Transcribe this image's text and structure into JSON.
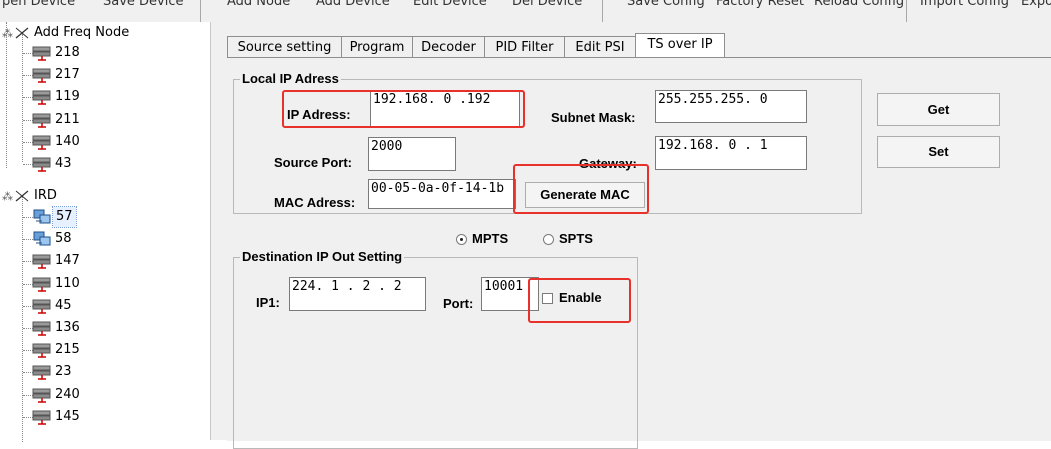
{
  "menu": [
    "pen Device",
    "Save Device",
    "Add Node",
    "Add Device",
    "Edit Device",
    "Del Device",
    "Save Config",
    "Factory Reset",
    "Reload Config",
    "Import Config",
    "Expo"
  ],
  "tree": {
    "freq_node_label": "Add Freq Node",
    "freq_items": [
      "218",
      "217",
      "119",
      "211",
      "140",
      "43"
    ],
    "ird_label": "IRD",
    "ird_items": [
      "57",
      "58",
      "147",
      "110",
      "45",
      "136",
      "215",
      "23",
      "240",
      "145"
    ],
    "selected": "57"
  },
  "tabs": [
    "Source setting",
    "Program",
    "Decoder",
    "PID Filter",
    "Edit PSI",
    "TS over IP"
  ],
  "active_tab": "TS over IP",
  "local_ip": {
    "title": "Local IP Adress",
    "ip_label": "IP Adress:",
    "ip_value": "192.168. 0 .192",
    "subnet_label": "Subnet Mask:",
    "subnet_value": "255.255.255. 0",
    "port_label": "Source Port:",
    "port_value": "2000",
    "gateway_label": "Gateway:",
    "gateway_value": "192.168. 0 . 1",
    "mac_label": "MAC Adress:",
    "mac_value": "00-05-0a-0f-14-1b",
    "generate_mac": "Generate MAC",
    "get": "Get",
    "set": "Set"
  },
  "mode": {
    "mpts": "MPTS",
    "spts": "SPTS",
    "selected": "MPTS"
  },
  "dest": {
    "title": "Destination IP Out Setting",
    "ip1_label": "IP1:",
    "ip1_value": "224. 1 . 2 . 2",
    "port_label": "Port:",
    "port_value": "10001",
    "enable_label": "Enable",
    "enable_checked": false
  },
  "colors": {
    "highlight": "#e8312a",
    "selection": "#3399ff"
  },
  "icons": {
    "device": "device-icon",
    "group": "group-icon",
    "ird_device": "ird-device-icon"
  }
}
